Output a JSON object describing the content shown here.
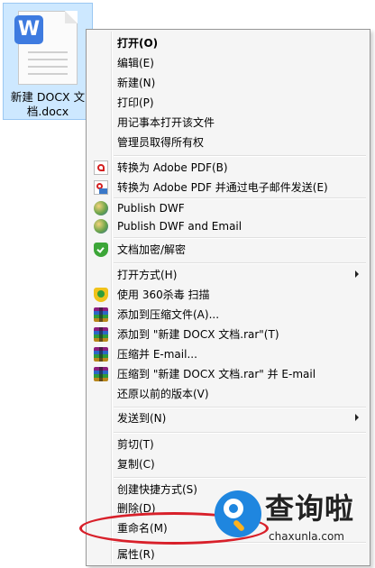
{
  "file": {
    "badge": "W",
    "name_line1": "新建 DOCX 文",
    "name_line2": "档.docx"
  },
  "menu": {
    "items": [
      {
        "label": "打开(O)",
        "icon": "none",
        "bold": true
      },
      {
        "label": "编辑(E)",
        "icon": "none"
      },
      {
        "label": "新建(N)",
        "icon": "none"
      },
      {
        "label": "打印(P)",
        "icon": "none"
      },
      {
        "label": "用记事本打开该文件",
        "icon": "none"
      },
      {
        "label": "管理员取得所有权",
        "icon": "none"
      },
      {
        "label": "转换为 Adobe PDF(B)",
        "icon": "pdf-icon"
      },
      {
        "label": "转换为 Adobe PDF 并通过电子邮件发送(E)",
        "icon": "pdf-email-icon"
      },
      {
        "label": "Publish DWF",
        "icon": "dwf-globe-icon"
      },
      {
        "label": "Publish DWF and Email",
        "icon": "dwf-globe-icon"
      },
      {
        "label": "文档加密/解密",
        "icon": "shield-icon"
      },
      {
        "label": "打开方式(H)",
        "icon": "none",
        "submenu": true
      },
      {
        "label": "使用 360杀毒 扫描",
        "icon": "360-shield-icon"
      },
      {
        "label": "添加到压缩文件(A)...",
        "icon": "winrar-icon"
      },
      {
        "label": "添加到 \"新建 DOCX 文档.rar\"(T)",
        "icon": "winrar-icon"
      },
      {
        "label": "压缩并 E-mail...",
        "icon": "winrar-icon"
      },
      {
        "label": "压缩到 \"新建 DOCX 文档.rar\" 并 E-mail",
        "icon": "winrar-icon"
      },
      {
        "label": "还原以前的版本(V)",
        "icon": "none"
      },
      {
        "label": "发送到(N)",
        "icon": "none",
        "submenu": true
      },
      {
        "label": "剪切(T)",
        "icon": "none"
      },
      {
        "label": "复制(C)",
        "icon": "none"
      },
      {
        "label": "创建快捷方式(S)",
        "icon": "none"
      },
      {
        "label": "删除(D)",
        "icon": "none"
      },
      {
        "label": "重命名(M)",
        "icon": "none"
      },
      {
        "label": "属性(R)",
        "icon": "none"
      }
    ]
  },
  "watermark": {
    "cn": "查询啦",
    "en": "chaxunla.com"
  },
  "colors": {
    "highlight": "#d8202a",
    "selection": "#cde8ff",
    "menu_bg": "#f5f5f5"
  }
}
